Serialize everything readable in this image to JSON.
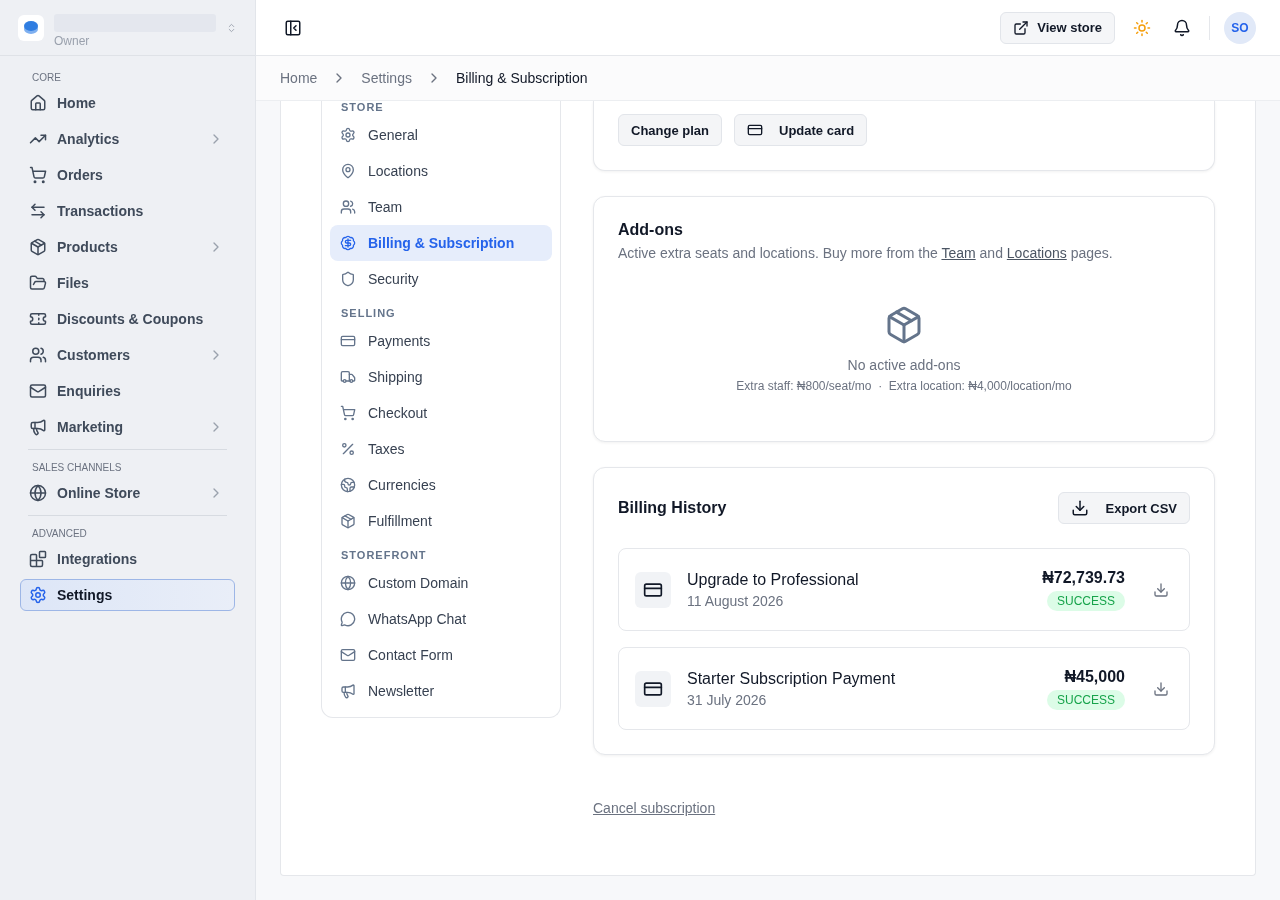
{
  "workspace": {
    "role": "Owner"
  },
  "sidebar": {
    "sections": [
      {
        "title": "CORE",
        "items": [
          {
            "label": "Home",
            "has_submenu": false,
            "selected": false
          },
          {
            "label": "Analytics",
            "has_submenu": true,
            "selected": false
          },
          {
            "label": "Orders",
            "has_submenu": false,
            "selected": false
          },
          {
            "label": "Transactions",
            "has_submenu": false,
            "selected": false
          },
          {
            "label": "Products",
            "has_submenu": true,
            "selected": false
          },
          {
            "label": "Files",
            "has_submenu": false,
            "selected": false
          },
          {
            "label": "Discounts & Coupons",
            "has_submenu": false,
            "selected": false
          },
          {
            "label": "Customers",
            "has_submenu": true,
            "selected": false
          },
          {
            "label": "Enquiries",
            "has_submenu": false,
            "selected": false
          },
          {
            "label": "Marketing",
            "has_submenu": true,
            "selected": false
          }
        ]
      },
      {
        "title": "SALES CHANNELS",
        "items": [
          {
            "label": "Online Store",
            "has_submenu": true,
            "selected": false
          }
        ]
      },
      {
        "title": "ADVANCED",
        "items": [
          {
            "label": "Integrations",
            "has_submenu": false,
            "selected": false
          },
          {
            "label": "Settings",
            "has_submenu": false,
            "selected": true
          }
        ]
      }
    ]
  },
  "header": {
    "view_store": "View store",
    "avatar": "SO"
  },
  "breadcrumb": [
    "Home",
    "Settings",
    "Billing & Subscription"
  ],
  "settings_nav": [
    {
      "title": "STORE",
      "items": [
        {
          "label": "General",
          "selected": false
        },
        {
          "label": "Locations",
          "selected": false
        },
        {
          "label": "Team",
          "selected": false
        },
        {
          "label": "Billing & Subscription",
          "selected": true
        },
        {
          "label": "Security",
          "selected": false
        }
      ]
    },
    {
      "title": "SELLING",
      "items": [
        {
          "label": "Payments",
          "selected": false
        },
        {
          "label": "Shipping",
          "selected": false
        },
        {
          "label": "Checkout",
          "selected": false
        },
        {
          "label": "Taxes",
          "selected": false
        },
        {
          "label": "Currencies",
          "selected": false
        },
        {
          "label": "Fulfillment",
          "selected": false
        }
      ]
    },
    {
      "title": "STOREFRONT",
      "items": [
        {
          "label": "Custom Domain",
          "selected": false
        },
        {
          "label": "WhatsApp Chat",
          "selected": false
        },
        {
          "label": "Contact Form",
          "selected": false
        },
        {
          "label": "Newsletter",
          "selected": false
        }
      ]
    }
  ],
  "plan_actions": {
    "change_plan": "Change plan",
    "update_card": "Update card"
  },
  "addons": {
    "title": "Add-ons",
    "description_before": "Active extra seats and locations. Buy more from the",
    "team_link": "Team",
    "and": "and",
    "locations_link": "Locations",
    "description_after": "pages.",
    "empty_title": "No active add-ons",
    "pricing": "Extra staff: ₦800/seat/mo  ·  Extra location: ₦4,000/location/mo"
  },
  "billing_history": {
    "title": "Billing History",
    "export": "Export CSV",
    "rows": [
      {
        "title": "Upgrade to Professional",
        "date": "11 August 2026",
        "amount": "₦72,739.73",
        "status": "SUCCESS"
      },
      {
        "title": "Starter Subscription Payment",
        "date": "31 July 2026",
        "amount": "₦45,000",
        "status": "SUCCESS"
      }
    ]
  },
  "cancel_link": "Cancel subscription"
}
